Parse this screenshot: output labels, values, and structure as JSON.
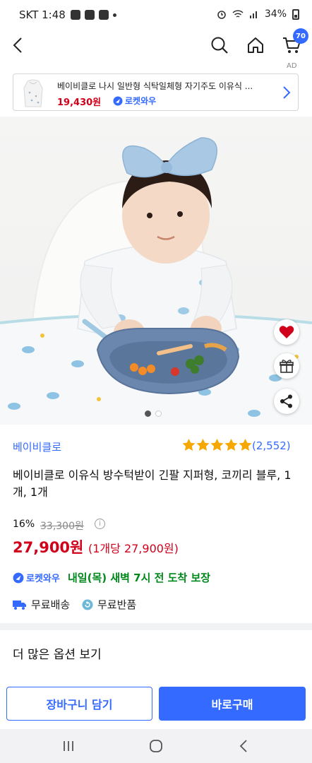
{
  "status_bar": {
    "carrier_time": "SKT 1:48",
    "battery": "34%"
  },
  "header": {
    "cart_count": "70",
    "ad_label": "AD"
  },
  "ad_banner": {
    "title": "베이비클로 나시 일반형 식탁일체형 자기주도 이유식 ...",
    "price": "19,430원",
    "badge": "로켓와우"
  },
  "product": {
    "brand": "베이비클로",
    "rating_stars": 5,
    "review_count": "(2,552)",
    "title": "베이비클로 이유식 방수턱받이 긴팔 지퍼형, 코끼리 블루, 1개, 1개",
    "discount": "16%",
    "original_price": "33,300원",
    "price": "27,900원",
    "unit_price": "(1개당 27,900원)",
    "rocket_badge": "로켓와우",
    "delivery": "내일(목) 새벽 7시 전 도착 보장",
    "free_shipping": "무료배송",
    "free_return": "무료반품"
  },
  "gallery": {
    "page_count": 2,
    "current_page": 1
  },
  "options": {
    "more_label": "더 많은 옵션 보기"
  },
  "actions": {
    "cart_label": "장바구니 담기",
    "buy_label": "바로구매"
  },
  "colors": {
    "accent": "#346aff",
    "price": "#d0021b",
    "delivery": "#00891a"
  }
}
